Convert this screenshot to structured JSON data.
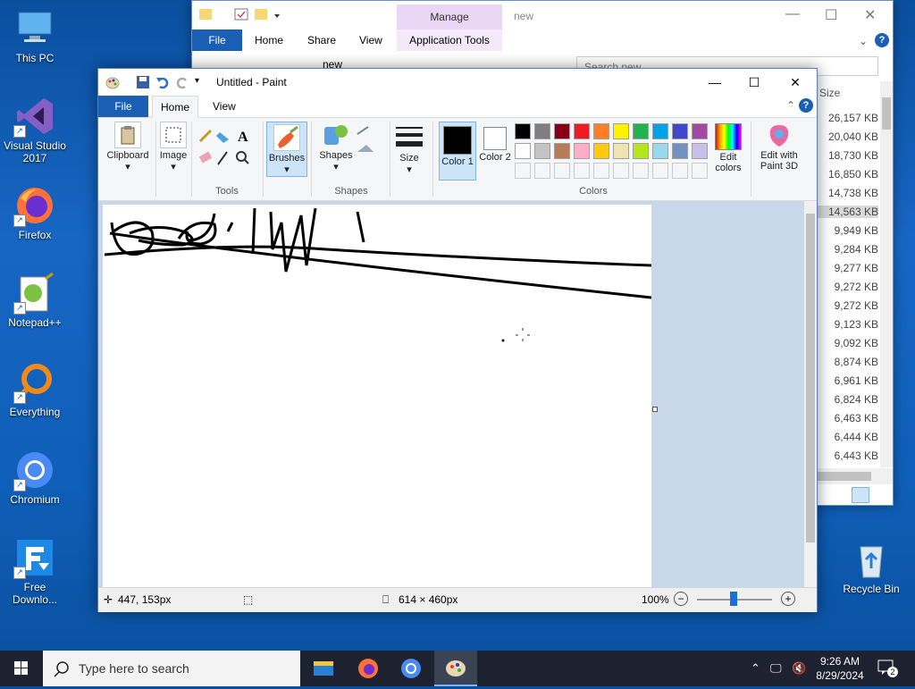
{
  "desktop": {
    "icons": [
      {
        "label": "This PC"
      },
      {
        "label": "Visual Studio 2017"
      },
      {
        "label": "Firefox"
      },
      {
        "label": "Notepad++"
      },
      {
        "label": "Everything"
      },
      {
        "label": "Chromium"
      },
      {
        "label": "Free Downlo..."
      },
      {
        "label": "Recycle Bin"
      }
    ]
  },
  "explorer": {
    "manage_label": "Manage",
    "title": "new",
    "tabs": [
      "File",
      "Home",
      "Share",
      "View",
      "Application Tools"
    ],
    "address": "new",
    "search_placeholder": "Search new",
    "size_header": "Size",
    "sizes": [
      "26,157 KB",
      "20,040 KB",
      "18,730 KB",
      "16,850 KB",
      "14,738 KB",
      "14,563 KB",
      "9,949 KB",
      "9,284 KB",
      "9,277 KB",
      "9,272 KB",
      "9,272 KB",
      "9,123 KB",
      "9,092 KB",
      "8,874 KB",
      "6,961 KB",
      "6,824 KB",
      "6,463 KB",
      "6,444 KB",
      "6,443 KB"
    ]
  },
  "paint": {
    "title": "Untitled - Paint",
    "tabs": {
      "file": "File",
      "home": "Home",
      "view": "View"
    },
    "ribbon": {
      "clipboard": "Clipboard",
      "image": "Image",
      "tools": "Tools",
      "brushes": "Brushes",
      "shapes_btn": "Shapes",
      "shapes_group": "Shapes",
      "size": "Size",
      "color1": "Color 1",
      "color2": "Color 2",
      "edit_colors": "Edit colors",
      "edit_paint3d": "Edit with Paint 3D",
      "colors_group": "Colors"
    },
    "palette": [
      "#000000",
      "#7f7f7f",
      "#880015",
      "#ed1c24",
      "#ff7f27",
      "#fff200",
      "#22b14c",
      "#00a2e8",
      "#3f48cc",
      "#a349a4",
      "#ffffff",
      "#c3c3c3",
      "#b97a57",
      "#ffaec9",
      "#ffc90e",
      "#efe4b0",
      "#b5e61d",
      "#99d9ea",
      "#7092be",
      "#c8bfe7"
    ],
    "status": {
      "cursor_pos": "447, 153px",
      "canvas_size": "614 × 460px",
      "zoom": "100%"
    }
  },
  "taskbar": {
    "search_placeholder": "Type here to search",
    "time": "9:26 AM",
    "date": "8/29/2024",
    "notifications": "2"
  }
}
